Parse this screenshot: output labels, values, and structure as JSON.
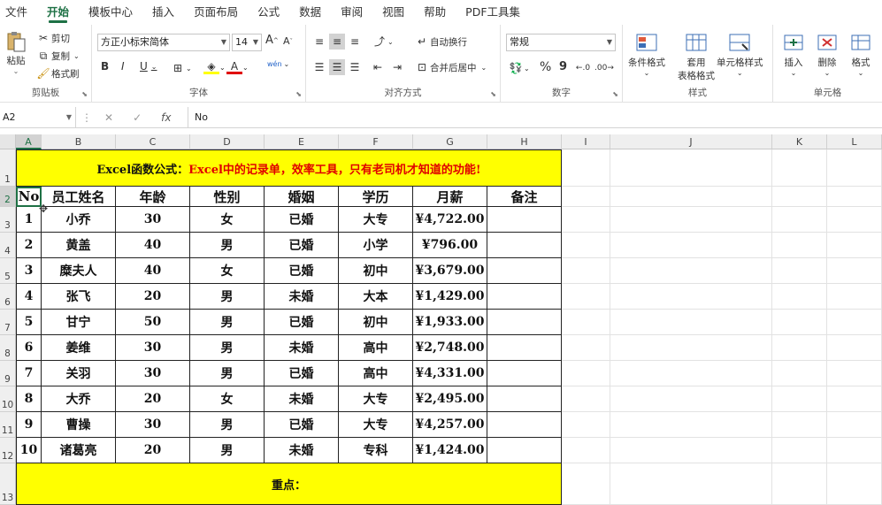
{
  "ribbon_tabs": [
    "文件",
    "开始",
    "模板中心",
    "插入",
    "页面布局",
    "公式",
    "数据",
    "审阅",
    "视图",
    "帮助",
    "PDF工具集"
  ],
  "active_tab": "开始",
  "clipboard": {
    "paste": "粘贴",
    "cut": "剪切",
    "copy": "复制",
    "format_painter": "格式刷",
    "label": "剪贴板"
  },
  "font": {
    "family": "方正小标宋简体",
    "size": "14",
    "label": "字体",
    "grow": "A",
    "shrink": "A",
    "bold": "B",
    "italic": "I",
    "underline": "U",
    "phonetic": "wén"
  },
  "alignment": {
    "wrap": "自动换行",
    "merge": "合并后居中",
    "label": "对齐方式"
  },
  "number": {
    "format": "常规",
    "percent": "%",
    "comma": "9",
    "label": "数字"
  },
  "styles": {
    "conditional": "条件格式",
    "table_l1": "套用",
    "table_l2": "表格格式",
    "cell_styles": "单元格样式",
    "label": "样式"
  },
  "cells": {
    "insert": "插入",
    "delete": "删除",
    "format": "格式",
    "label": "单元格"
  },
  "formula_bar": {
    "name_box": "A2",
    "fx": "fx",
    "content": "No"
  },
  "columns": [
    "A",
    "B",
    "C",
    "D",
    "E",
    "F",
    "G",
    "H",
    "I",
    "J",
    "K",
    "L"
  ],
  "rows": [
    "1",
    "2",
    "3",
    "4",
    "5",
    "6",
    "7",
    "8",
    "9",
    "10",
    "11",
    "12",
    "13"
  ],
  "sheet": {
    "title_black": "Excel函数公式：",
    "title_red": "Excel中的记录单，效率工具，只有老司机才知道的功能!",
    "headers": [
      "No",
      "员工姓名",
      "年龄",
      "性别",
      "婚姻",
      "学历",
      "月薪",
      "备注"
    ],
    "records": [
      [
        "1",
        "小乔",
        "30",
        "女",
        "已婚",
        "大专",
        "¥4,722.00",
        ""
      ],
      [
        "2",
        "黄盖",
        "40",
        "男",
        "已婚",
        "小学",
        "¥796.00",
        ""
      ],
      [
        "3",
        "糜夫人",
        "40",
        "女",
        "已婚",
        "初中",
        "¥3,679.00",
        ""
      ],
      [
        "4",
        "张飞",
        "20",
        "男",
        "未婚",
        "大本",
        "¥1,429.00",
        ""
      ],
      [
        "5",
        "甘宁",
        "50",
        "男",
        "已婚",
        "初中",
        "¥1,933.00",
        ""
      ],
      [
        "6",
        "姜维",
        "30",
        "男",
        "未婚",
        "高中",
        "¥2,748.00",
        ""
      ],
      [
        "7",
        "关羽",
        "30",
        "男",
        "已婚",
        "高中",
        "¥4,331.00",
        ""
      ],
      [
        "8",
        "大乔",
        "20",
        "女",
        "未婚",
        "大专",
        "¥2,495.00",
        ""
      ],
      [
        "9",
        "曹操",
        "30",
        "男",
        "已婚",
        "大专",
        "¥4,257.00",
        ""
      ],
      [
        "10",
        "诸葛亮",
        "20",
        "男",
        "未婚",
        "专科",
        "¥1,424.00",
        ""
      ]
    ],
    "footer": "重点："
  },
  "colors": {
    "accent": "#1e7145",
    "highlight": "#ffff00",
    "title_red": "#e00000"
  }
}
